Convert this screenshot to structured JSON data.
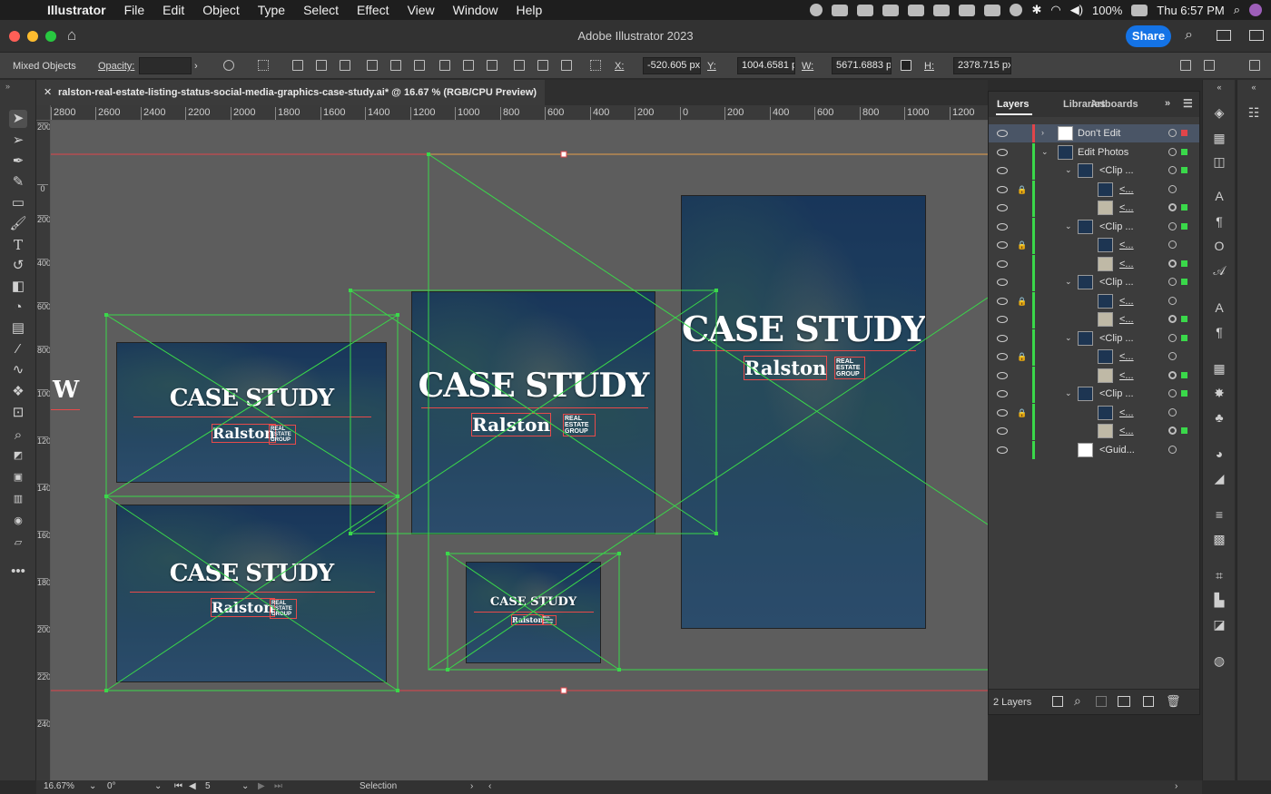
{
  "menubar": {
    "app": "Illustrator",
    "items": [
      "File",
      "Edit",
      "Object",
      "Type",
      "Select",
      "Effect",
      "View",
      "Window",
      "Help"
    ],
    "battery": "100%",
    "clock": "Thu 6:57 PM"
  },
  "window": {
    "title": "Adobe Illustrator 2023",
    "share_label": "Share"
  },
  "controlbar": {
    "selection_type": "Mixed Objects",
    "opacity_label": "Opacity:",
    "x_label": "X:",
    "x_value": "-520.605 px",
    "y_label": "Y:",
    "y_value": "1004.6581 px",
    "w_label": "W:",
    "w_value": "5671.6883 px",
    "h_label": "H:",
    "h_value": "2378.715 px"
  },
  "document": {
    "tab_title": "ralston-real-estate-listing-status-social-media-graphics-case-study.ai* @ 16.67 % (RGB/CPU Preview)"
  },
  "rulers": {
    "horizontal": [
      "2800",
      "2600",
      "2400",
      "2200",
      "2000",
      "1800",
      "1600",
      "1400",
      "1200",
      "1000",
      "800",
      "600",
      "400",
      "200",
      "0",
      "200",
      "400",
      "600",
      "800",
      "1000",
      "1200"
    ],
    "vertical": [
      "200",
      "0",
      "200",
      "400",
      "600",
      "800",
      "1000",
      "1200",
      "1400",
      "1600",
      "1800",
      "2000",
      "2200",
      "2400"
    ]
  },
  "artboards": {
    "title": "CASE STUDY",
    "brand": "Ralston",
    "brand_sub": "REAL ESTATE GROUP",
    "edge_text": "W"
  },
  "layers_panel": {
    "tabs": [
      "Layers",
      "Libraries",
      "Artboards"
    ],
    "rows": [
      {
        "name": "Don't Edit",
        "depth": 0,
        "twirl": "right",
        "locked": false,
        "color": "#e0454a",
        "selected": true,
        "sel_color": "#e0454a",
        "target": "single"
      },
      {
        "name": "Edit Photos",
        "depth": 0,
        "twirl": "down",
        "locked": false,
        "color": "#3ad84a",
        "selected": false,
        "sel_color": "#3ad84a",
        "target": "single"
      },
      {
        "name": "<Clip ...",
        "depth": 1,
        "twirl": "down",
        "locked": false,
        "color": "#3ad84a",
        "selected": false,
        "sel_color": "#3ad84a",
        "target": "single"
      },
      {
        "name": "<...",
        "depth": 2,
        "twirl": "",
        "locked": true,
        "color": "#3ad84a",
        "selected": false,
        "sel_color": "",
        "target": "single"
      },
      {
        "name": "<...",
        "depth": 2,
        "twirl": "",
        "locked": false,
        "color": "#3ad84a",
        "selected": false,
        "sel_color": "#3ad84a",
        "target": "double"
      },
      {
        "name": "<Clip ...",
        "depth": 1,
        "twirl": "down",
        "locked": false,
        "color": "#3ad84a",
        "selected": false,
        "sel_color": "#3ad84a",
        "target": "single"
      },
      {
        "name": "<...",
        "depth": 2,
        "twirl": "",
        "locked": true,
        "color": "#3ad84a",
        "selected": false,
        "sel_color": "",
        "target": "single"
      },
      {
        "name": "<...",
        "depth": 2,
        "twirl": "",
        "locked": false,
        "color": "#3ad84a",
        "selected": false,
        "sel_color": "#3ad84a",
        "target": "double"
      },
      {
        "name": "<Clip ...",
        "depth": 1,
        "twirl": "down",
        "locked": false,
        "color": "#3ad84a",
        "selected": false,
        "sel_color": "#3ad84a",
        "target": "single"
      },
      {
        "name": "<...",
        "depth": 2,
        "twirl": "",
        "locked": true,
        "color": "#3ad84a",
        "selected": false,
        "sel_color": "",
        "target": "single"
      },
      {
        "name": "<...",
        "depth": 2,
        "twirl": "",
        "locked": false,
        "color": "#3ad84a",
        "selected": false,
        "sel_color": "#3ad84a",
        "target": "double"
      },
      {
        "name": "<Clip ...",
        "depth": 1,
        "twirl": "down",
        "locked": false,
        "color": "#3ad84a",
        "selected": false,
        "sel_color": "#3ad84a",
        "target": "single"
      },
      {
        "name": "<...",
        "depth": 2,
        "twirl": "",
        "locked": true,
        "color": "#3ad84a",
        "selected": false,
        "sel_color": "",
        "target": "single"
      },
      {
        "name": "<...",
        "depth": 2,
        "twirl": "",
        "locked": false,
        "color": "#3ad84a",
        "selected": false,
        "sel_color": "#3ad84a",
        "target": "double"
      },
      {
        "name": "<Clip ...",
        "depth": 1,
        "twirl": "down",
        "locked": false,
        "color": "#3ad84a",
        "selected": false,
        "sel_color": "#3ad84a",
        "target": "single"
      },
      {
        "name": "<...",
        "depth": 2,
        "twirl": "",
        "locked": true,
        "color": "#3ad84a",
        "selected": false,
        "sel_color": "",
        "target": "single"
      },
      {
        "name": "<...",
        "depth": 2,
        "twirl": "",
        "locked": false,
        "color": "#3ad84a",
        "selected": false,
        "sel_color": "#3ad84a",
        "target": "double"
      },
      {
        "name": "<Guid...",
        "depth": 1,
        "twirl": "",
        "locked": false,
        "color": "#3ad84a",
        "selected": false,
        "sel_color": "",
        "target": "single"
      }
    ],
    "layer_count": "2 Layers"
  },
  "statusbar": {
    "zoom": "16.67%",
    "rotation": "0°",
    "artboard_number": "5",
    "tool_name": "Selection"
  },
  "colors": {
    "accent": "#1473e6",
    "guide_green": "#3ad84a",
    "guide_red": "#e0454a"
  }
}
